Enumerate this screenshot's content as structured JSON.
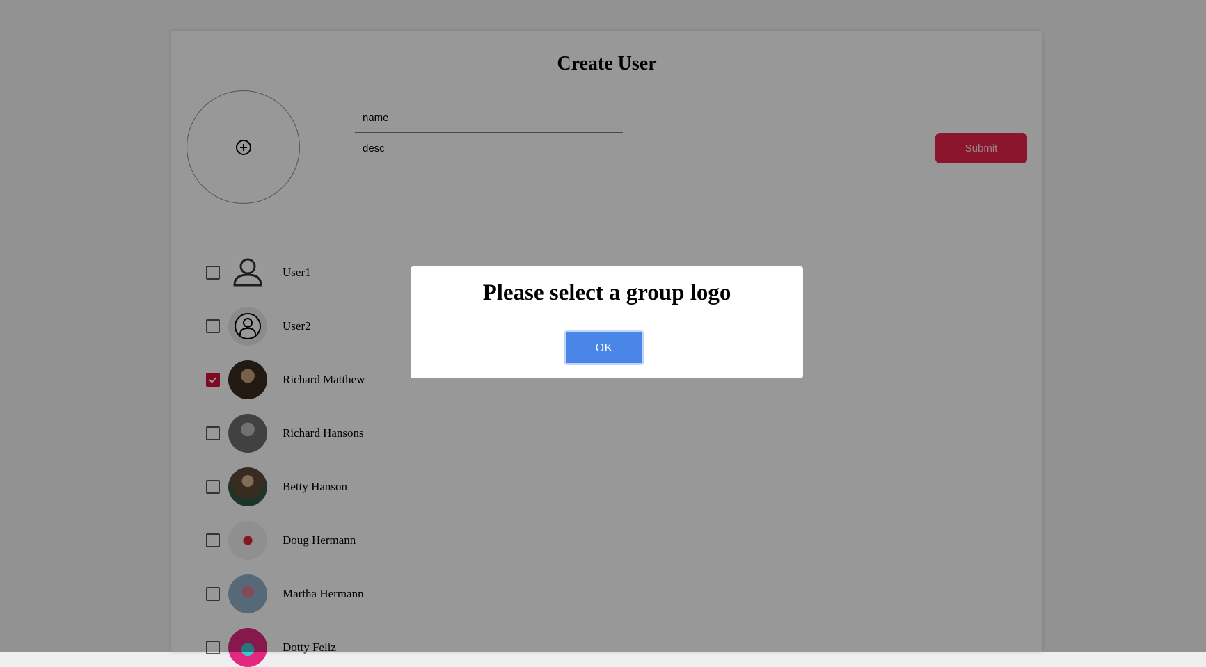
{
  "form": {
    "title": "Create User",
    "name_placeholder": "name",
    "desc_placeholder": "desc",
    "submit_label": "Submit"
  },
  "users": [
    {
      "name": "User1",
      "checked": false,
      "avatar": "person-outline-icon"
    },
    {
      "name": "User2",
      "checked": false,
      "avatar": "person-circle-icon"
    },
    {
      "name": "Richard Matthew",
      "checked": true,
      "avatar": "photo"
    },
    {
      "name": "Richard Hansons",
      "checked": false,
      "avatar": "photo"
    },
    {
      "name": "Betty Hanson",
      "checked": false,
      "avatar": "photo"
    },
    {
      "name": "Doug Hermann",
      "checked": false,
      "avatar": "photo"
    },
    {
      "name": "Martha Hermann",
      "checked": false,
      "avatar": "photo"
    },
    {
      "name": "Dotty Feliz",
      "checked": false,
      "avatar": "photo"
    }
  ],
  "dialog": {
    "message": "Please select a group logo",
    "ok_label": "OK"
  },
  "colors": {
    "accent": "#e8234a",
    "checkbox_checked": "#d0103a",
    "ok_button": "#4a86e8"
  }
}
